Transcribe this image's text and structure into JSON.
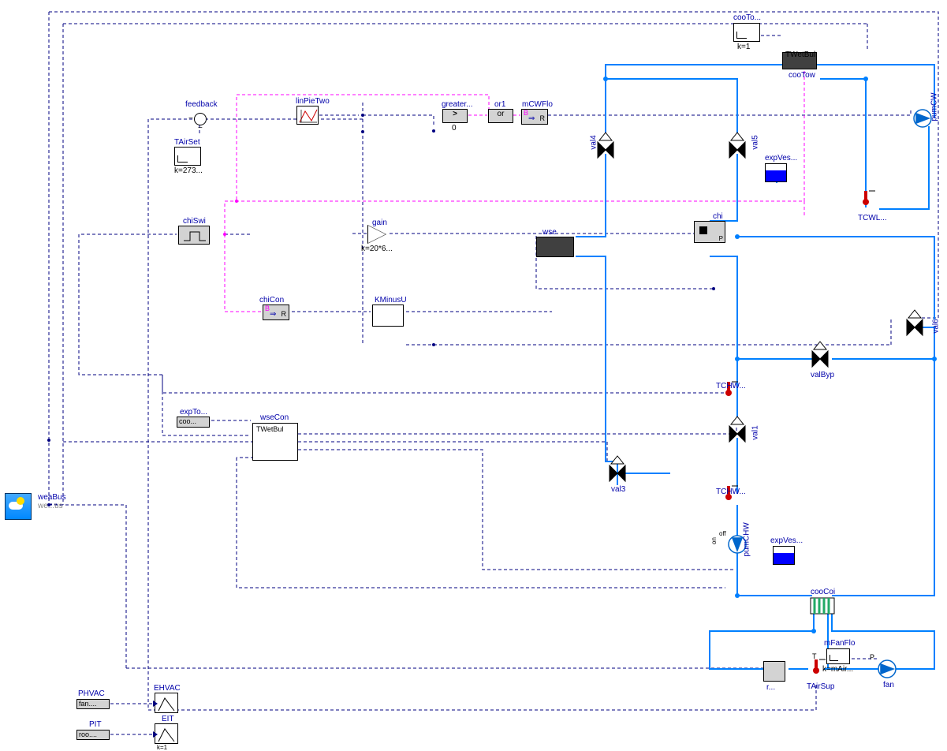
{
  "labels": {
    "feedback": "feedback",
    "TAirSet": "TAirSet",
    "TAirSet_k": "k=273...",
    "linPieTwo": "linPieTwo",
    "greater": "greater...",
    "greater_sub": "0",
    "or1": "or1",
    "or1_text": "or",
    "mCWFlo": "mCWFlo",
    "b2r": "R",
    "b_prefix": "B",
    "arrow": "⇒",
    "chiSwi": "chiSwi",
    "gain": "gain",
    "gain_k": "k=20*6...",
    "chiCon": "chiCon",
    "KMinusU": "KMinusU",
    "wse": "wse",
    "chi": "chi",
    "expVes1": "expVes...",
    "val4": "val4",
    "val5": "val5",
    "val6": "val6",
    "valByp": "valByp",
    "val1": "val1",
    "val3": "val3",
    "TCHW_top": "TCHW...",
    "TCHW_bot": "TCHW...",
    "TCWL": "TCWL...",
    "pumCW": "pumCW",
    "pumCHW": "pumCHW",
    "expVes2": "expVes...",
    "cooCoi": "cooCoi",
    "mFanFlo": "mFanFlo",
    "mFanFlo_k": "k=mAir...",
    "fan": "fan",
    "TAirSup": "TAirSup",
    "roo": "r...",
    "cooTow_k": "k=1",
    "cooTo": "cooTo...",
    "cooTow": "cooTow",
    "TWetBul": "TWetBul",
    "TWet2": "TWetBul",
    "wseCon": "wseCon",
    "expTo": "expTo...",
    "expTo_txt": "coo...",
    "weaBus": "weaBus",
    "weaBus2": "we...us",
    "PHVAC": "PHVAC",
    "PHVAC_txt": "fan....",
    "PIT": "PIT",
    "PIT_txt": "roo....",
    "EHVAC": "EHVAC",
    "EIT": "EIT",
    "off": "off",
    "on": "on",
    "gt": ">",
    "T": "T",
    "P": "P",
    "k1_sub": "k=1"
  }
}
